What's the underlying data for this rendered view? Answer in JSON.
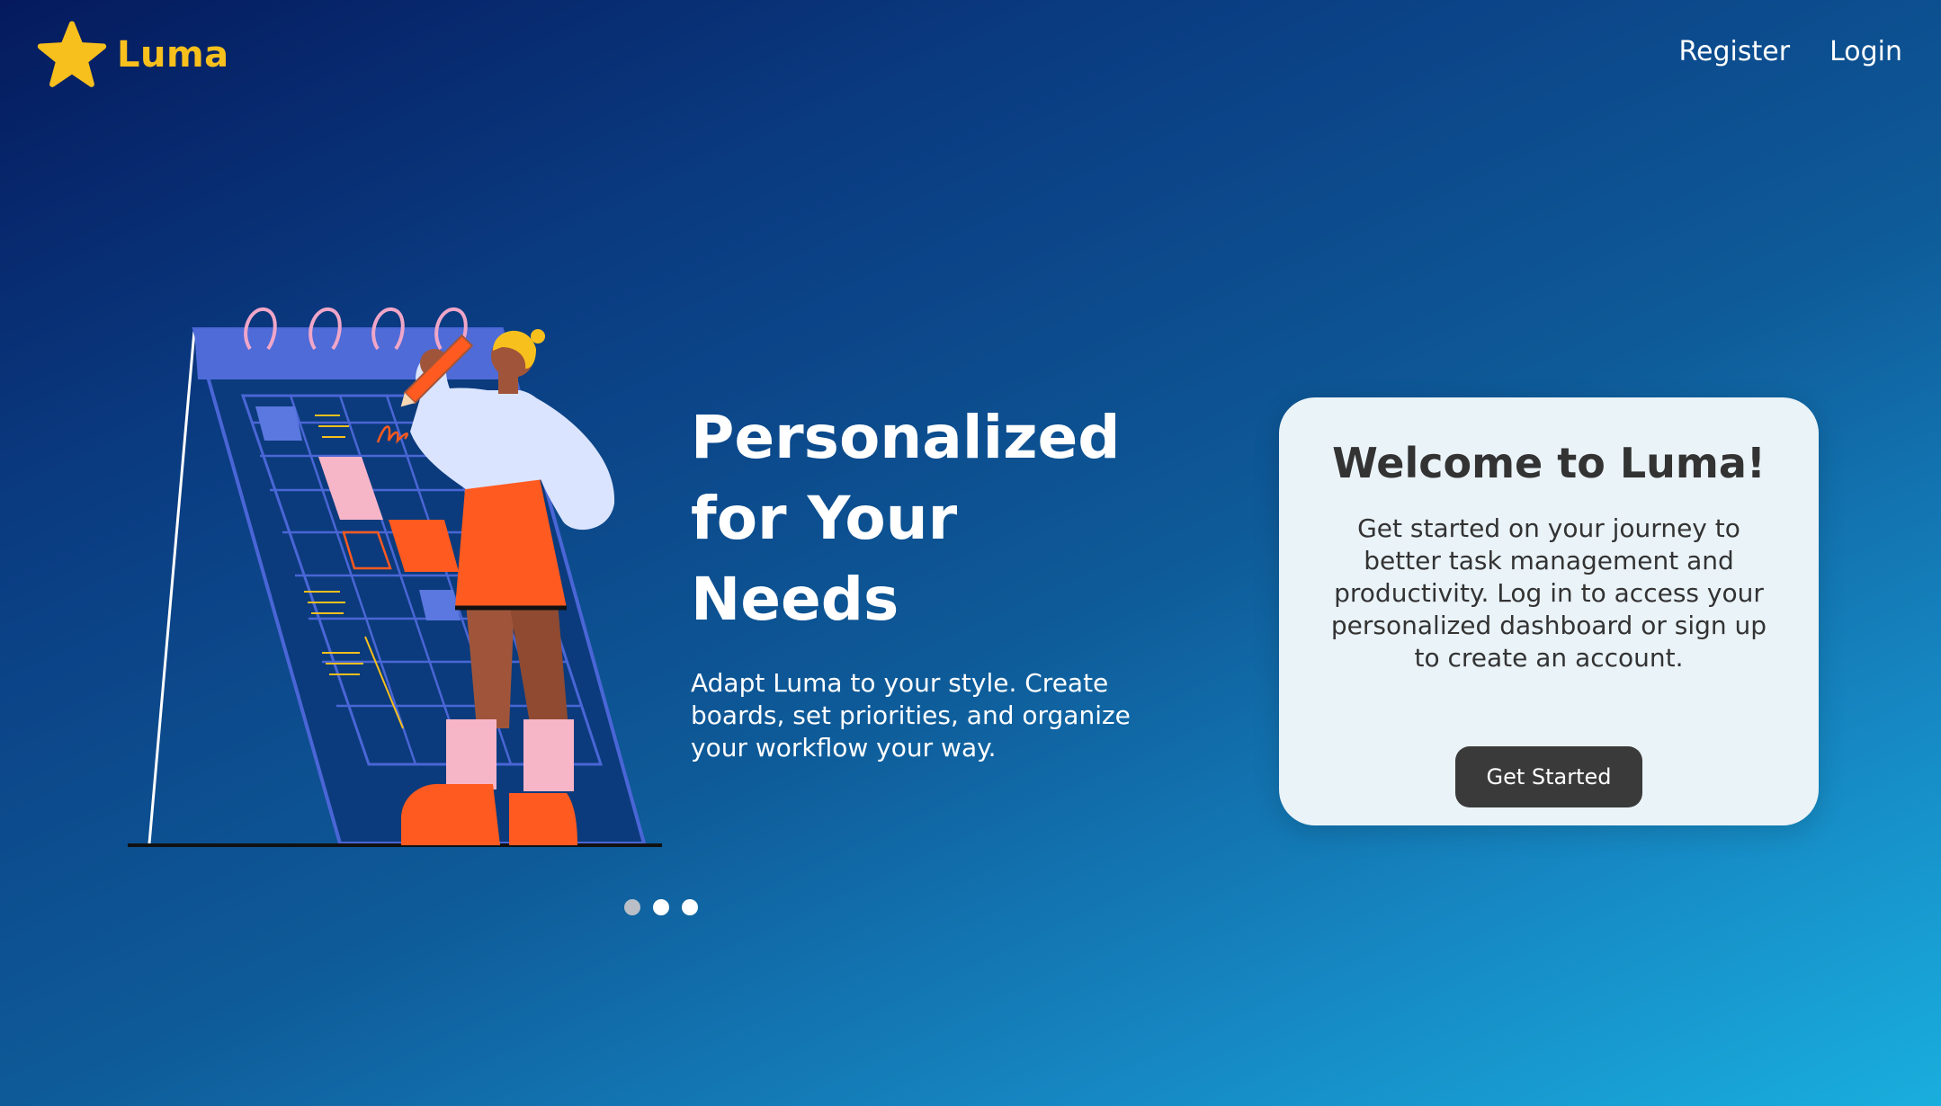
{
  "brand": {
    "name": "Luma",
    "logo_icon": "star-icon",
    "accent_color": "#f8c01d"
  },
  "nav": {
    "links": [
      {
        "label": "Register"
      },
      {
        "label": "Login"
      }
    ]
  },
  "hero": {
    "title_lines": [
      "Personalized",
      "for Your",
      "Needs"
    ],
    "subtitle": "Adapt Luma to your style. Create boards, set priorities, and organize your workflow your way.",
    "illustration": "person-writing-on-calendar-illustration"
  },
  "carousel": {
    "slide_count": 3,
    "active_index": 0
  },
  "welcome_card": {
    "title": "Welcome to Luma!",
    "body": "Get started on your journey to better task management and productivity. Log in to access your personalized dashboard or sign up to create an account.",
    "button_label": "Get Started",
    "button_color": "#3a3a3a"
  },
  "theme": {
    "gradient_start": "#051a5e",
    "gradient_end": "#19aedd"
  }
}
